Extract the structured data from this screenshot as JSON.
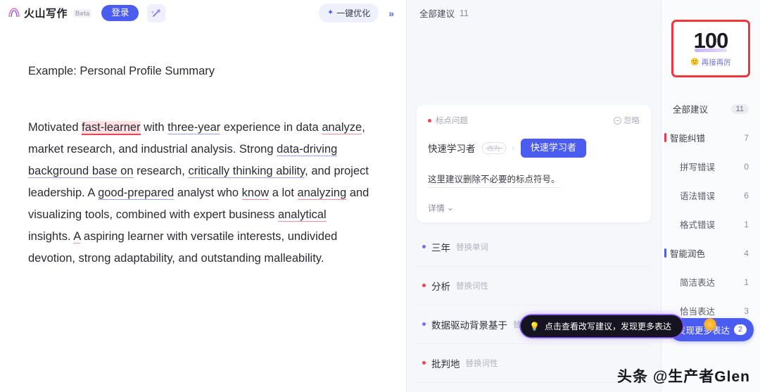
{
  "topbar": {
    "logo_text": "火山写作",
    "beta_badge": "Beta",
    "login_label": "登录",
    "magic_icon": "magic-wand-icon",
    "optimize_label": "一键优化",
    "optimize_spark_icon": "sparkle-icon",
    "collapse_icon": "»"
  },
  "document": {
    "title": "Example: Personal Profile Summary",
    "paragraph_segments": [
      {
        "text": "Motivated ",
        "mark": "none"
      },
      {
        "text": "fast-learner",
        "mark": "error-red"
      },
      {
        "text": " with ",
        "mark": "none"
      },
      {
        "text": "three-year",
        "mark": "underline-blue"
      },
      {
        "text": " experience in data ",
        "mark": "none"
      },
      {
        "text": "analyze",
        "mark": "underline-red"
      },
      {
        "text": ", market research, and industrial analysis. Strong ",
        "mark": "none"
      },
      {
        "text": "data-driving background base on",
        "mark": "underline-blue"
      },
      {
        "text": " research, ",
        "mark": "none"
      },
      {
        "text": "critically thinking ability",
        "mark": "underline-blue"
      },
      {
        "text": ", and project leadership. A ",
        "mark": "none"
      },
      {
        "text": "good-prepared",
        "mark": "underline-blue"
      },
      {
        "text": " analyst who ",
        "mark": "none"
      },
      {
        "text": "know",
        "mark": "underline-red"
      },
      {
        "text": " a lot ",
        "mark": "none"
      },
      {
        "text": "analyzing",
        "mark": "underline-red"
      },
      {
        "text": " and visualizing tools, combined with expert business ",
        "mark": "none"
      },
      {
        "text": "analytical",
        "mark": "underline-red"
      },
      {
        "text": " insights. ",
        "mark": "none"
      },
      {
        "text": "A",
        "mark": "underline-red"
      },
      {
        "text": " aspiring learner with versatile interests, undivided devotion, strong adaptability, and outstanding malleability.",
        "mark": "none"
      }
    ]
  },
  "suggestions_panel": {
    "header_label": "全部建议",
    "header_count": "11",
    "card": {
      "tag_label": "标点问题",
      "tag_dot_color": "#ef4352",
      "ignore_label": "忽略",
      "ignore_icon": "circle-minus-icon",
      "old_word": "快速学习者",
      "old_pill": "改为",
      "arrow_icon": "arrow-right-icon",
      "new_word": "快速学习者",
      "description": "这里建议删除不必要的标点符号。",
      "more_label": "详情",
      "more_icon": "chevron-down-icon"
    },
    "items": [
      {
        "word": "三年",
        "action": "替换单词",
        "dot_color": "#7b6cf0"
      },
      {
        "word": "分析",
        "action": "替换词性",
        "dot_color": "#ef4352"
      },
      {
        "word": "数据驱动背景基于",
        "action": "替换词组",
        "dot_color": "#7b6cf0"
      },
      {
        "word": "批判地",
        "action": "替换词性",
        "dot_color": "#ef4352"
      }
    ]
  },
  "score": {
    "value": "100",
    "emoji": "🙂",
    "caption": "再接再厉",
    "border_color": "#f5333f"
  },
  "filters": [
    {
      "label": "全部建议",
      "count": "11",
      "bar": "none",
      "level": "all"
    },
    {
      "label": "智能纠错",
      "count": "7",
      "bar": "red",
      "level": "group"
    },
    {
      "label": "拼写错误",
      "count": "0",
      "bar": "none",
      "level": "sub"
    },
    {
      "label": "语法错误",
      "count": "6",
      "bar": "none",
      "level": "sub"
    },
    {
      "label": "格式错误",
      "count": "1",
      "bar": "none",
      "level": "sub"
    },
    {
      "label": "智能润色",
      "count": "4",
      "bar": "blue",
      "level": "group"
    },
    {
      "label": "简洁表达",
      "count": "1",
      "bar": "none",
      "level": "sub"
    },
    {
      "label": "恰当表达",
      "count": "3",
      "bar": "none",
      "level": "sub"
    }
  ],
  "discover_button": {
    "label": "发现更多表达",
    "badge": "2"
  },
  "tooltip": {
    "icon": "lightbulb-icon",
    "text": "点击查看改写建议，发现更多表达"
  },
  "watermark": {
    "text": "头条 @生产者Glen"
  }
}
